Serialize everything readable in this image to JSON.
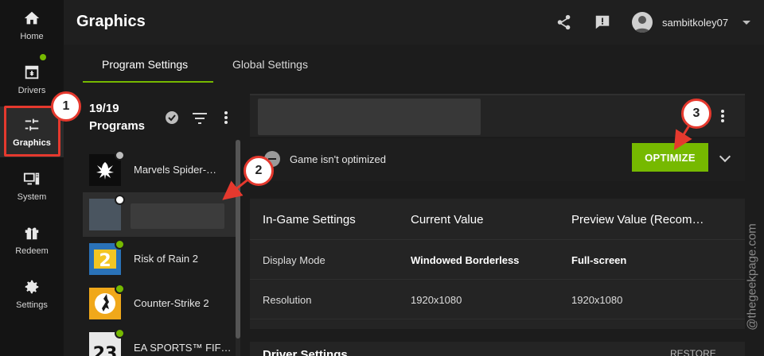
{
  "nav": {
    "items": [
      {
        "label": "Home",
        "icon": "home-icon"
      },
      {
        "label": "Drivers",
        "icon": "download-icon"
      },
      {
        "label": "Graphics",
        "icon": "sliders-icon"
      },
      {
        "label": "System",
        "icon": "monitor-icon"
      },
      {
        "label": "Redeem",
        "icon": "gift-icon"
      },
      {
        "label": "Settings",
        "icon": "gear-icon"
      }
    ],
    "active": "Graphics"
  },
  "header": {
    "title": "Graphics",
    "username": "sambitkoley07"
  },
  "tabs": [
    {
      "label": "Program Settings"
    },
    {
      "label": "Global Settings"
    }
  ],
  "programs": {
    "count_label": "19/19",
    "title": "Programs",
    "items": [
      {
        "name": "Marvels Spider-…"
      },
      {
        "name": ""
      },
      {
        "name": "Risk of Rain 2"
      },
      {
        "name": "Counter-Strike 2"
      },
      {
        "name": "EA SPORTS™ FIF…"
      }
    ]
  },
  "detail": {
    "status_text": "Game isn't optimized",
    "optimize_label": "OPTIMIZE",
    "table": {
      "headers": [
        "In-Game Settings",
        "Current Value",
        "Preview Value (Recom…"
      ],
      "rows": [
        {
          "setting": "Display Mode",
          "current": "Windowed Borderless",
          "preview": "Full-screen"
        },
        {
          "setting": "Resolution",
          "current": "1920x1080",
          "preview": "1920x1080"
        }
      ]
    },
    "driver_settings_title": "Driver Settings",
    "restore_label": "RESTORE"
  },
  "annotations": [
    "1",
    "2",
    "3"
  ],
  "watermark": "@thegeekpage.com",
  "colors": {
    "accent": "#76b900",
    "callout": "#e5392e"
  }
}
